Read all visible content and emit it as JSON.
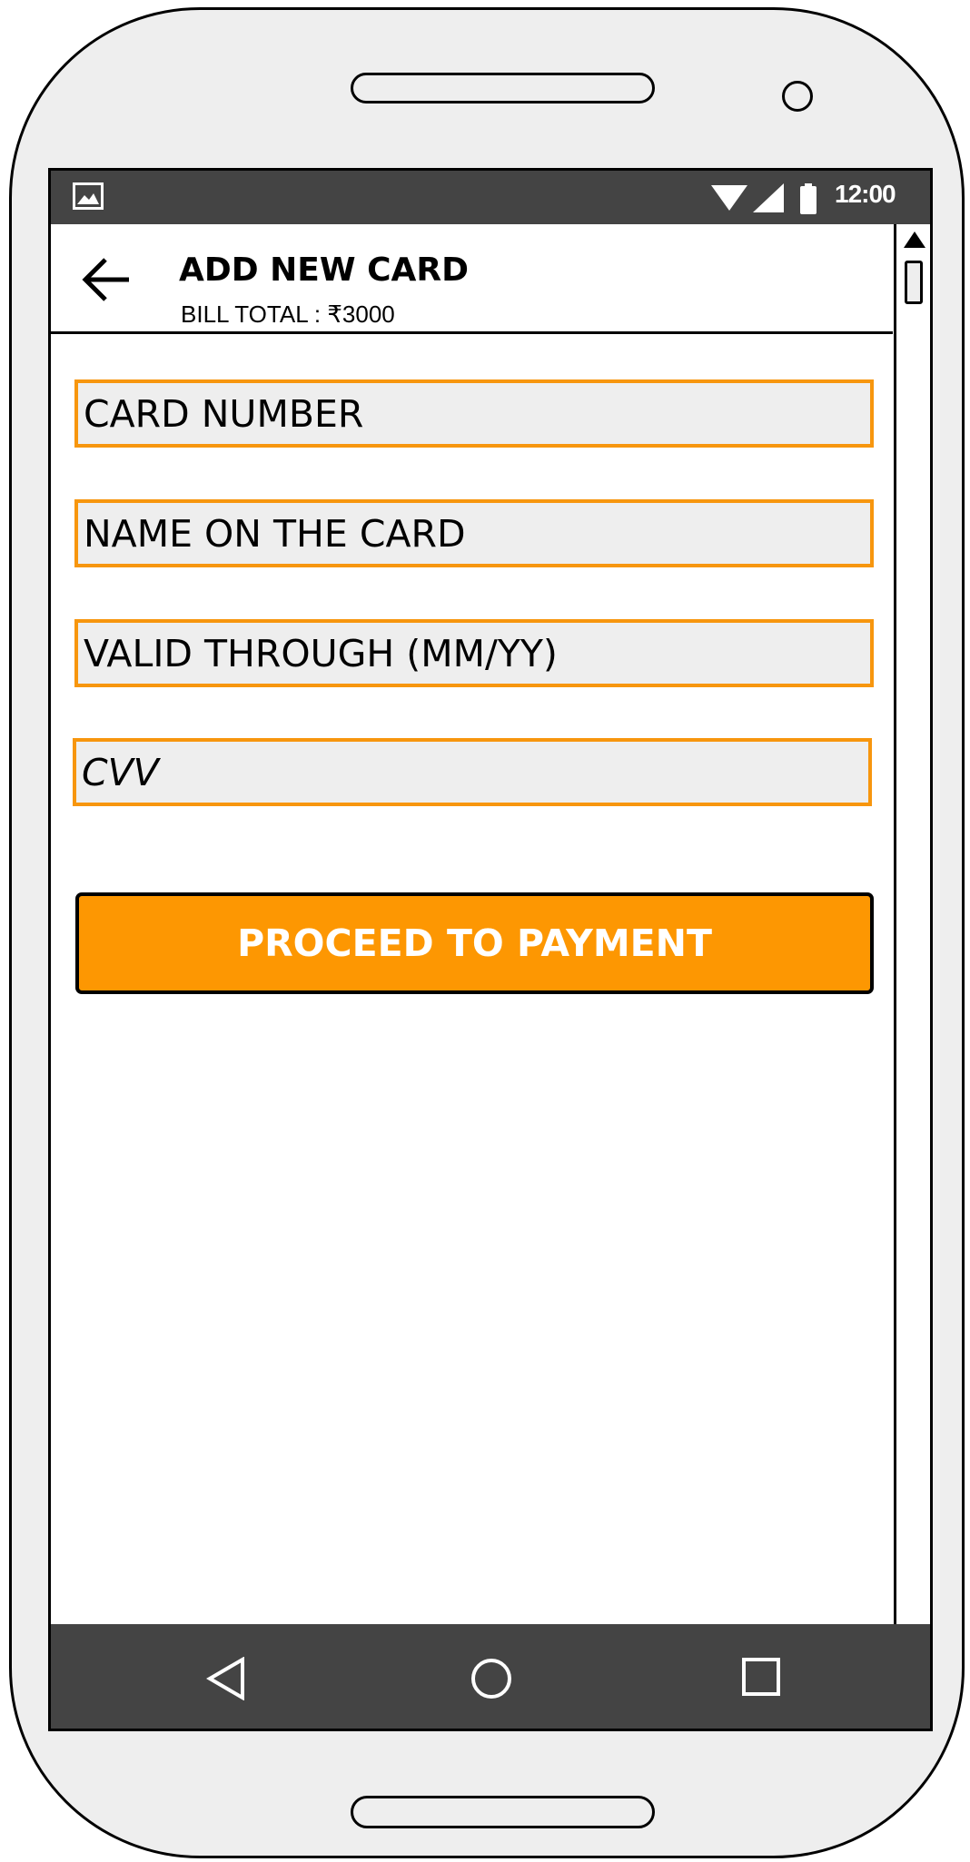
{
  "status_bar": {
    "time": "12:00",
    "icons": [
      "image-icon",
      "wifi-icon",
      "signal-icon",
      "battery-icon"
    ]
  },
  "app_bar": {
    "back_icon": "back-arrow-icon",
    "title": "ADD NEW CARD",
    "subtitle": "BILL TOTAL : ₹3000"
  },
  "form": {
    "card_number_placeholder": "CARD NUMBER",
    "name_placeholder": "NAME ON THE CARD",
    "valid_through_placeholder": "VALID THROUGH (MM/YY)",
    "cvv_placeholder": "CVV"
  },
  "proceed_button_label": "PROCEED TO PAYMENT",
  "nav_bar": {
    "icons": [
      "back-triangle-icon",
      "home-circle-icon",
      "recents-square-icon"
    ]
  },
  "colors": {
    "accent": "#fd9702",
    "field_border": "#f7960e",
    "bar_background": "#444444",
    "field_background": "#eeeeee"
  }
}
